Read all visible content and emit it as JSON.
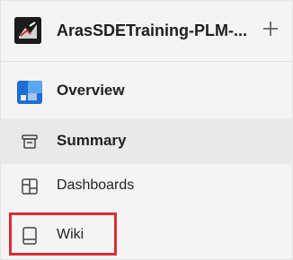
{
  "header": {
    "project_name": "ArasSDETraining-PLM-...",
    "add_icon": "plus-icon"
  },
  "nav": {
    "items": [
      {
        "label": "Overview",
        "icon": "overview-icon"
      },
      {
        "label": "Summary",
        "icon": "summary-icon"
      },
      {
        "label": "Dashboards",
        "icon": "dashboards-icon"
      },
      {
        "label": "Wiki",
        "icon": "wiki-icon"
      }
    ]
  },
  "colors": {
    "accent_blue": "#2b79d4",
    "highlight_red": "#d63035",
    "selected_bg": "#e9e9e9"
  }
}
